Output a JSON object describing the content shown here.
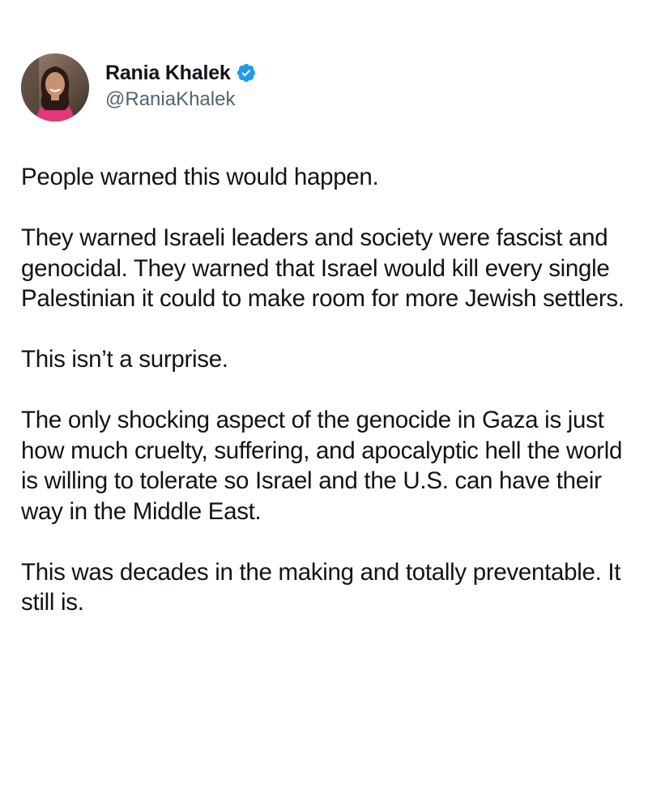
{
  "author": {
    "display_name": "Rania Khalek",
    "handle": "@RaniaKhalek",
    "verified": true,
    "verified_color": "#1d9bf0"
  },
  "tweet": {
    "paragraphs": [
      "People warned this would happen.",
      "They warned Israeli leaders and society were fascist and genocidal. They warned that Israel would kill every single Palestinian it could to make room for more Jewish settlers.",
      "This isn’t a surprise.",
      "The only shocking aspect of the genocide in Gaza is just how much cruelty, suffering, and apocalyptic hell the world is willing to tolerate so Israel and the U.S. can have their way in the Middle East.",
      "This was decades in the making and totally preventable. It still is."
    ]
  },
  "icons": {
    "verified": "verified-badge-icon",
    "avatar": "profile-photo"
  }
}
